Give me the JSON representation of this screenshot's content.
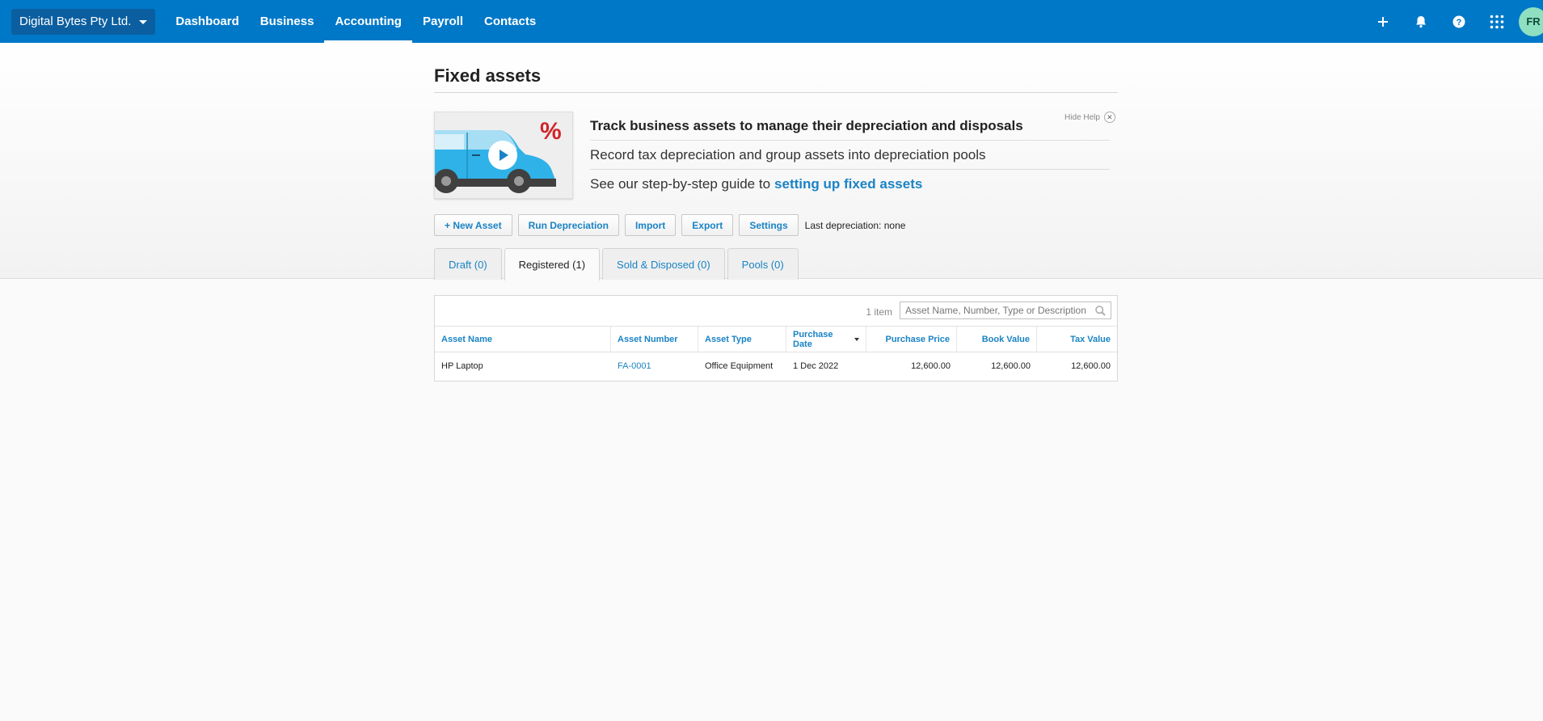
{
  "topbar": {
    "org_name": "Digital Bytes Pty Ltd.",
    "nav": [
      {
        "label": "Dashboard",
        "active": false
      },
      {
        "label": "Business",
        "active": false
      },
      {
        "label": "Accounting",
        "active": true
      },
      {
        "label": "Payroll",
        "active": false
      },
      {
        "label": "Contacts",
        "active": false
      }
    ],
    "icons": [
      "plus-icon",
      "bell-icon",
      "help-icon",
      "apps-grid-icon"
    ],
    "avatar_initials": "FR",
    "brand_color": "#0078c8"
  },
  "page": {
    "title": "Fixed assets"
  },
  "help": {
    "line1": "Track business assets to manage their depreciation and disposals",
    "line2": "Record tax depreciation and group assets into depreciation pools",
    "line3_prefix": "See our step-by-step guide to",
    "line3_link": "setting up fixed assets",
    "hide_label": "Hide Help",
    "thumb_badge": "%"
  },
  "toolbar": {
    "new_asset": "+ New Asset",
    "run_depreciation": "Run Depreciation",
    "import": "Import",
    "export": "Export",
    "settings": "Settings",
    "last_depreciation": "Last depreciation: none"
  },
  "tabs": {
    "draft": "Draft (0)",
    "registered": "Registered (1)",
    "sold_disposed": "Sold & Disposed (0)",
    "pools": "Pools (0)"
  },
  "table": {
    "item_count": "1 item",
    "search_placeholder": "Asset Name, Number, Type or Description",
    "columns": {
      "name": "Asset Name",
      "number": "Asset Number",
      "type": "Asset Type",
      "purchase_date": "Purchase Date",
      "purchase_price": "Purchase Price",
      "book_value": "Book Value",
      "tax_value": "Tax Value"
    },
    "rows": [
      {
        "name": "HP Laptop",
        "number": "FA-0001",
        "type": "Office Equipment",
        "purchase_date": "1 Dec 2022",
        "purchase_price": "12,600.00",
        "book_value": "12,600.00",
        "tax_value": "12,600.00"
      }
    ]
  }
}
